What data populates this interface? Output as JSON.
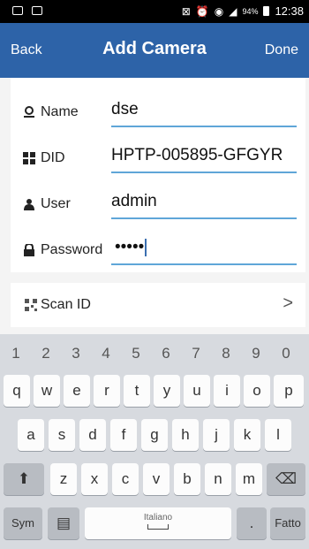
{
  "status_bar": {
    "battery": "94%",
    "time": "12:38"
  },
  "navbar": {
    "back": "Back",
    "title": "Add Camera",
    "done": "Done"
  },
  "fields": [
    {
      "label": "Name",
      "value": "dse",
      "icon": "user-pin-icon"
    },
    {
      "label": "DID",
      "value": "HPTP-005895-GFGYR",
      "icon": "grid-icon"
    },
    {
      "label": "User",
      "value": "admin",
      "icon": "person-icon"
    },
    {
      "label": "Password",
      "value": "•••••",
      "icon": "lock-icon"
    }
  ],
  "scan": {
    "label": "Scan ID",
    "icon": "qr-icon",
    "chevron": ">"
  },
  "keyboard": {
    "numbers": [
      "1",
      "2",
      "3",
      "4",
      "5",
      "6",
      "7",
      "8",
      "9",
      "0"
    ],
    "row1": [
      "q",
      "w",
      "e",
      "r",
      "t",
      "y",
      "u",
      "i",
      "o",
      "p"
    ],
    "row2": [
      "a",
      "s",
      "d",
      "f",
      "g",
      "h",
      "j",
      "k",
      "l"
    ],
    "row3": [
      "z",
      "x",
      "c",
      "v",
      "b",
      "n",
      "m"
    ],
    "sym": "Sym",
    "space_label": "Italiano",
    "done": "Fatto",
    "dot": "."
  },
  "colors": {
    "accent": "#2d63a8",
    "underline": "#5fa6d8"
  }
}
